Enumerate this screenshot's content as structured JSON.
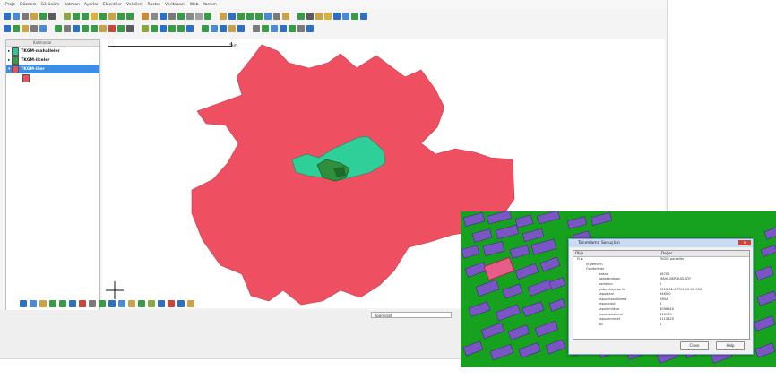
{
  "menu": [
    "Proje",
    "Düzenle",
    "Görünüm",
    "Katman",
    "Ayarlar",
    "Eklentiler",
    "Vektörel",
    "Raster",
    "Veritabanı",
    "Web",
    "Yardım"
  ],
  "toolbar1_colors": [
    "#2f6fbf",
    "#4c8ad6",
    "#7a7a7a",
    "#c9a34a",
    "#3a9a48",
    "#5b5b5b",
    "#8aa83f",
    "#3a9a48",
    "#3a9a48",
    "#d8b23c",
    "#3a9a48",
    "#c9a34a",
    "#3a9a48",
    "#3a9a48",
    "#c98a3a",
    "#8a8a8a",
    "#2f6fbf",
    "#7a7a7a",
    "#3a9a48",
    "#8a8a8a",
    "#a0a0a0",
    "#3a9a48",
    "#c9a34a",
    "#2f6fbf",
    "#3a9a48",
    "#3a9a48",
    "#3a9a48",
    "#4c8ad6",
    "#7a7a7a",
    "#c9a34a",
    "#3a9a48",
    "#5b5b5b",
    "#c9a34a",
    "#d8b23c",
    "#2f6fbf",
    "#4c8ad6",
    "#3a9a48",
    "#2f6fbf"
  ],
  "toolbar2_colors": [
    "#2f6fbf",
    "#3a9a48",
    "#c9a34a",
    "#7a7a7a",
    "#4c8ad6",
    "#3a9a48",
    "#7a7a7a",
    "#2f6fbf",
    "#3a9a48",
    "#3a9a48",
    "#c9a34a",
    "#c9453a",
    "#3a9a48",
    "#5b5b5b",
    "#8aa83f",
    "#3a9a48",
    "#2f6fbf",
    "#3a9a48",
    "#3a9a48",
    "#2f6fbf",
    "#3a9a48",
    "#4c8ad6",
    "#2f6fbf",
    "#c9a34a",
    "#2f6fbf",
    "#7a7a7a",
    "#3a9a48",
    "#4c8ad6",
    "#2f6fbf",
    "#3a9a48",
    "#7a7a7a",
    "#2f6fbf"
  ],
  "layers": {
    "header": "Katmanlar",
    "items": [
      {
        "label": "TKGM-mahalleler",
        "color": "#35c39a"
      },
      {
        "label": "TKGM-ilceler",
        "color": "#3a9a48"
      },
      {
        "label": "TKGM-iller",
        "color": "#e8505e",
        "selected": true
      }
    ]
  },
  "scale": {
    "label": "5km"
  },
  "bottom_tools_colors": [
    "#2f6fbf",
    "#4c8ad6",
    "#c9a34a",
    "#3a9a48",
    "#3a9a48",
    "#2f6fbf",
    "#c9453a",
    "#7a7a7a",
    "#3a9a48",
    "#2f6fbf",
    "#4c8ad6",
    "#c9a34a",
    "#3a9a48",
    "#8aa83f",
    "#2f6fbf",
    "#c9453a",
    "#2f6fbf",
    "#c9a34a"
  ],
  "status": {
    "coordinate_label": "Koordinat"
  },
  "colors": {
    "province": "#ee4f61",
    "district": "#2fcf9a",
    "parcel": "#7a55c4",
    "inset_bg": "#16a11f"
  },
  "dialog": {
    "title": "Tanımlama Sonuçları",
    "close": "✕",
    "col_feature": "Obje",
    "col_value": "Değer",
    "first_row_value": "TKGM-parseller",
    "rows": [
      {
        "k": "(Eylemler)",
        "v": ""
      },
      {
        "k": "Öznitelikler",
        "v": ""
      },
      {
        "k": "adano",
        "v": "18702"
      },
      {
        "k": "kadastralalan",
        "v": "MAHL.BERBUZLKÖY"
      },
      {
        "k": "parselno",
        "v": "5"
      },
      {
        "k": "sistemkayıttarihi",
        "v": "2013-02-06T01:00:00.000"
      },
      {
        "k": "tapualani",
        "v": "9465.0"
      },
      {
        "k": "tapucinsaciklama",
        "v": "ARSA"
      },
      {
        "k": "tapucinsid",
        "v": "1"
      },
      {
        "k": "tapukimlikno",
        "v": "3096640"
      },
      {
        "k": "tapumahalleref",
        "v": "110170"
      },
      {
        "k": "tapuzeminref",
        "v": "8115625"
      },
      {
        "k": "tip",
        "v": "1"
      }
    ],
    "buttons": {
      "close_label": "Close",
      "help_label": "Help"
    }
  }
}
